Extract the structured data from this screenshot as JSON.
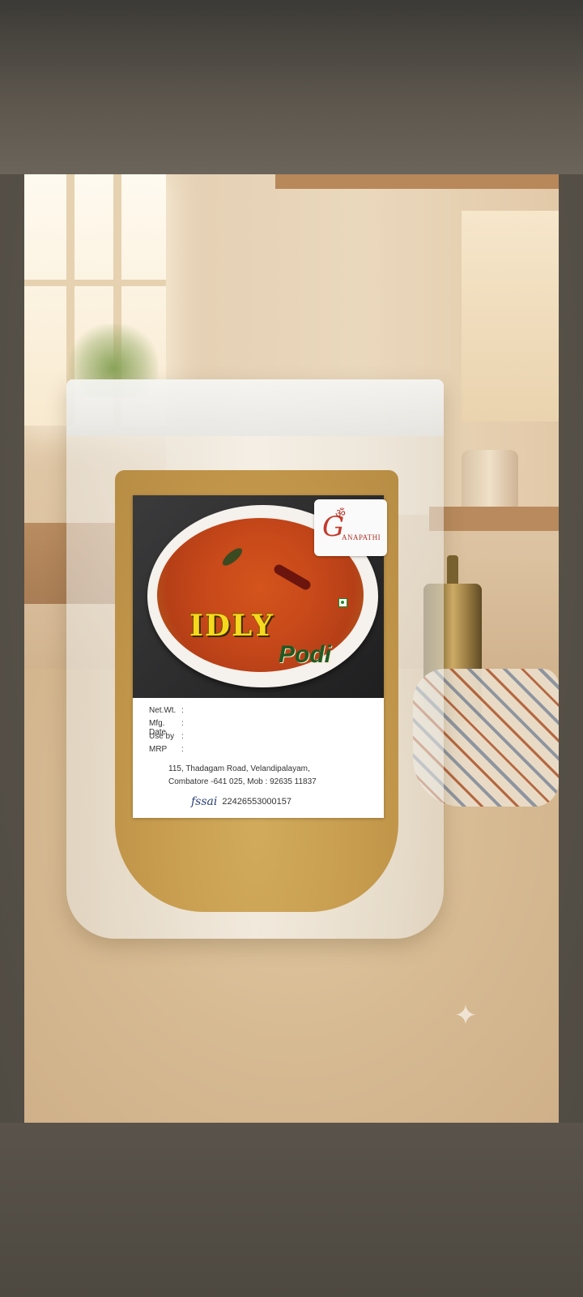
{
  "product": {
    "brand_logo": "ANAPATHI",
    "brand_logo_letter": "G",
    "title": "IDLY",
    "subtitle": "Podi",
    "fields": [
      {
        "key": "Net.Wt.",
        "sep": ":"
      },
      {
        "key": "Mfg. Date",
        "sep": ":"
      },
      {
        "key": "Use by",
        "sep": ":"
      },
      {
        "key": "MRP",
        "sep": ":"
      }
    ],
    "address_line1": "115, Thadagam Road, Velandipalayam,",
    "address_line2": "Combatore -641 025, Mob : 92635 11837",
    "fssai_mark": "fssai",
    "fssai_number": "22426553000157"
  },
  "icons": {
    "sparkle": "sparkle-icon",
    "veg": "veg-mark-icon",
    "logo": "ganesha-logo-icon"
  }
}
